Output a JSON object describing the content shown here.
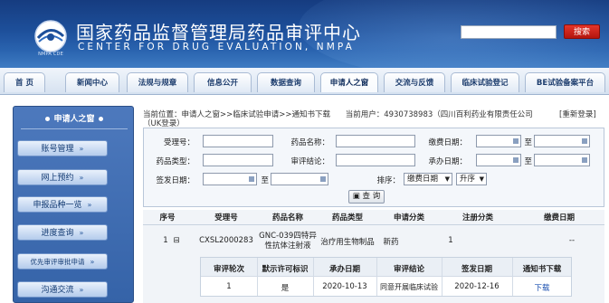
{
  "header": {
    "title_cn": "国家药品监督管理局药品审评中心",
    "title_en": "CENTER FOR DRUG EVALUATION, NMPA",
    "logo_caption": "NMPA CDE",
    "search_button": "搜索"
  },
  "nav": {
    "tabs": [
      "首 页",
      "新闻中心",
      "法规与规章",
      "信息公开",
      "数据查询",
      "申请人之窗",
      "交流与反馈",
      "临床试验登记",
      "BE试验备案平台"
    ],
    "active": "申请人之窗"
  },
  "sidebar": {
    "title": "申请人之窗",
    "items": [
      "账号管理",
      "网上预约",
      "申报品种一览",
      "进度查询",
      "优先审评审批申请",
      "沟通交流"
    ],
    "chevron": "»"
  },
  "breadcrumb": {
    "line1": "当前位置：申请人之窗>>临床试验申请>>通知书下载",
    "current_user": "当前用户：4930738983（四川百利药业有限责任公司",
    "line2": "（UK登录）",
    "relogin": "[重新登录]"
  },
  "form": {
    "labels": {
      "accept_no": "受理号：",
      "drug_name": "药品名称：",
      "pay_date": "缴费日期：",
      "drug_type": "药品类型：",
      "review_conclusion": "审评结论：",
      "undertake_date": "承办日期：",
      "sign_date": "签发日期：",
      "sort": "排序：",
      "to": "至"
    },
    "sort_field": "缴费日期",
    "sort_order": "升序",
    "query_button": "查 询"
  },
  "results": {
    "headers": [
      "序号",
      "受理号",
      "药品名称",
      "药品类型",
      "申请分类",
      "注册分类",
      "缴费日期"
    ],
    "row": {
      "index": "1",
      "toggle": "⊟",
      "accept_no": "CXSL2000283",
      "drug_name_line1": "GNC-039四特异",
      "drug_name_line2": "性抗体注射液",
      "drug_type": "治疗用生物制品",
      "app_class": "新药",
      "reg_class": "1",
      "pay_date": "--"
    },
    "sub_headers": [
      "审评轮次",
      "默示许可标识",
      "承办日期",
      "审评结论",
      "签发日期",
      "通知书下载"
    ],
    "sub_row": [
      "1",
      "是",
      "2020-10-13",
      "同意开展临床试验",
      "2020-12-16",
      "下载"
    ]
  },
  "colors": {
    "header_blue": "#1d4f9a",
    "sidebar_blue": "#3f6db3",
    "search_red": "#cc2a20",
    "link": "#1a4fb0"
  }
}
